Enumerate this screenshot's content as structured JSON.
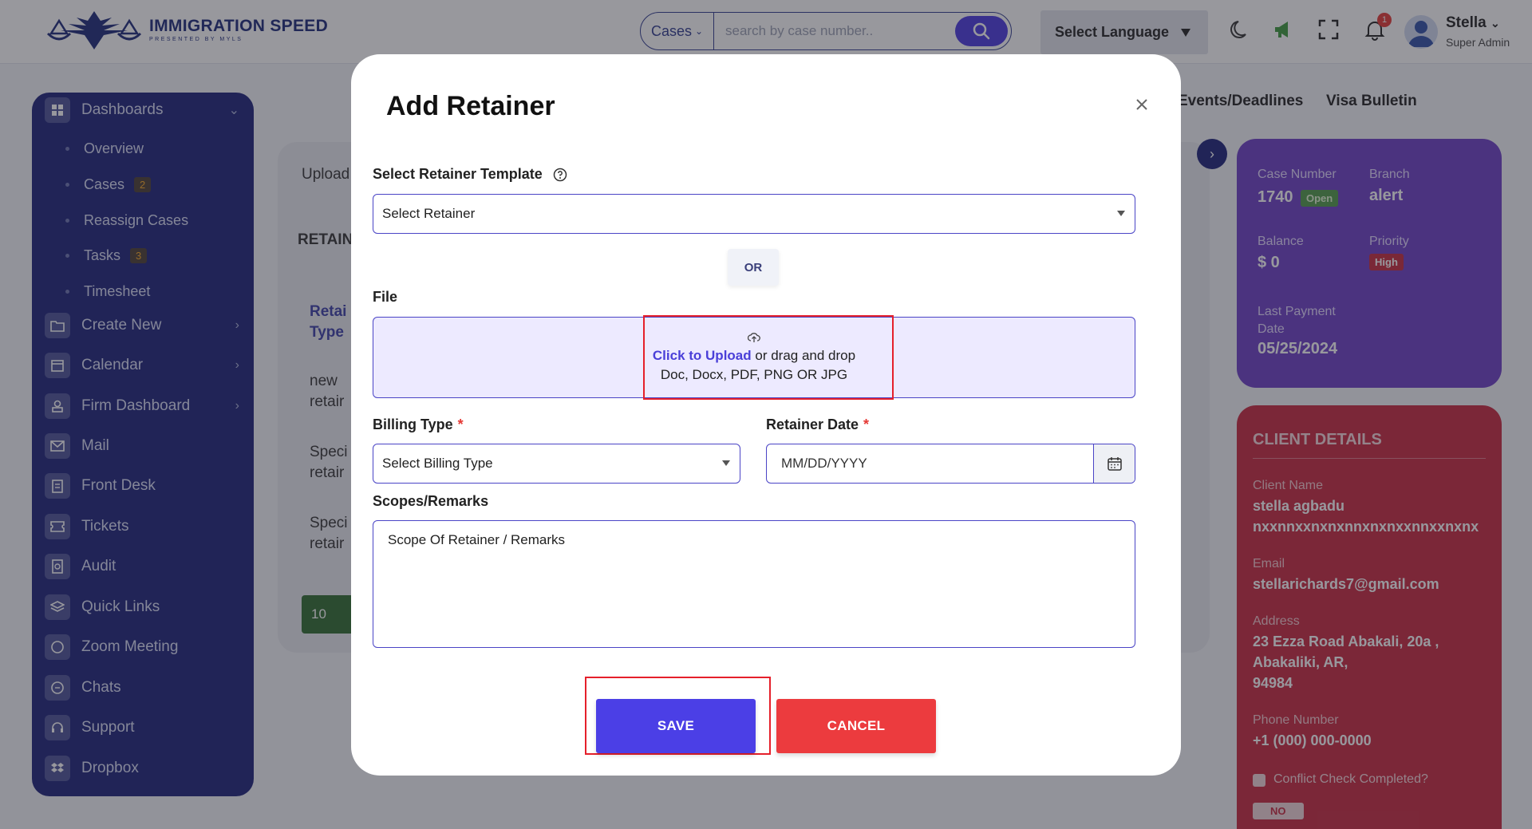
{
  "header": {
    "logo_title": "IMMIGRATION SPEED",
    "logo_sub": "PRESENTED BY MYLS",
    "search_type": "Cases",
    "search_placeholder": "search by case number..",
    "language_label": "Select Language",
    "notification_count": "1",
    "user_name": "Stella",
    "user_role": "Super Admin"
  },
  "sidebar": {
    "dashboards": "Dashboards",
    "sub_items": [
      {
        "label": "Overview",
        "badge": ""
      },
      {
        "label": "Cases",
        "badge": "2"
      },
      {
        "label": "Reassign Cases",
        "badge": ""
      },
      {
        "label": "Tasks",
        "badge": "3"
      },
      {
        "label": "Timesheet",
        "badge": ""
      }
    ],
    "items": [
      {
        "label": "Create New",
        "icon": "folder-plus-icon"
      },
      {
        "label": "Calendar",
        "icon": "calendar-icon"
      },
      {
        "label": "Firm Dashboard",
        "icon": "user-badge-icon"
      },
      {
        "label": "Mail",
        "icon": "mail-icon"
      },
      {
        "label": "Front Desk",
        "icon": "clipboard-icon"
      },
      {
        "label": "Tickets",
        "icon": "ticket-icon"
      },
      {
        "label": "Audit",
        "icon": "audit-icon"
      },
      {
        "label": "Quick Links",
        "icon": "layers-icon"
      },
      {
        "label": "Zoom Meeting",
        "icon": "chat-bubble-icon"
      },
      {
        "label": "Chats",
        "icon": "chat-icon"
      },
      {
        "label": "Support",
        "icon": "headset-icon"
      },
      {
        "label": "Dropbox",
        "icon": "dropbox-icon"
      }
    ]
  },
  "background": {
    "tab_events": "Events/Deadlines",
    "tab_visa": "Visa Bulletin",
    "upload_tab": "Upload",
    "section_heading": "RETAIN",
    "col_header_line1": "Retai",
    "col_header_line2": "Type",
    "rows": [
      {
        "l1": "new",
        "l2": "retair"
      },
      {
        "l1": "Speci",
        "l2": "retair"
      },
      {
        "l1": "Speci",
        "l2": "retair"
      }
    ],
    "page_size": "10"
  },
  "case_card": {
    "case_number_label": "Case Number",
    "case_number": "1740",
    "status": "Open",
    "branch_label": "Branch",
    "branch": "alert",
    "balance_label": "Balance",
    "balance": "$ 0",
    "priority_label": "Priority",
    "priority": "High",
    "last_payment_label_1": "Last Payment",
    "last_payment_label_2": "Date",
    "last_payment": "05/25/2024"
  },
  "client_card": {
    "title": "CLIENT DETAILS",
    "name_label": "Client Name",
    "name": "stella agbadu",
    "name_extra": "nxxnnxxnxnxnnxnxnxxnnxxnxnx",
    "email_label": "Email",
    "email": "stellarichards7@gmail.com",
    "address_label": "Address",
    "address_1": "23 Ezza Road Abakali, 20a ,",
    "address_2": "Abakaliki, AR,",
    "address_3": "94984",
    "phone_label": "Phone Number",
    "phone": "+1 (000) 000-0000",
    "conflict_label": "Conflict Check Completed?",
    "conflict_value": "NO"
  },
  "modal": {
    "title": "Add Retainer",
    "template_label": "Select Retainer Template",
    "template_value": "Select Retainer",
    "or_label": "OR",
    "file_label": "File",
    "upload_link": "Click to Upload",
    "upload_text": "or drag and drop",
    "upload_types": "Doc, Docx, PDF, PNG OR JPG",
    "billing_label": "Billing Type",
    "billing_value": "Select Billing Type",
    "date_label": "Retainer Date",
    "date_placeholder": "MM/DD/YYYY",
    "remarks_label": "Scopes/Remarks",
    "remarks_placeholder": "Scope Of Retainer / Remarks",
    "save_label": "SAVE",
    "cancel_label": "CANCEL"
  },
  "colors": {
    "sidebar": "#1b227a",
    "primary": "#4b3fe6",
    "danger": "#ec3b3e",
    "case_card": "#6b3fc6",
    "client_card": "#c8283f",
    "highlight": "#e5202b"
  }
}
